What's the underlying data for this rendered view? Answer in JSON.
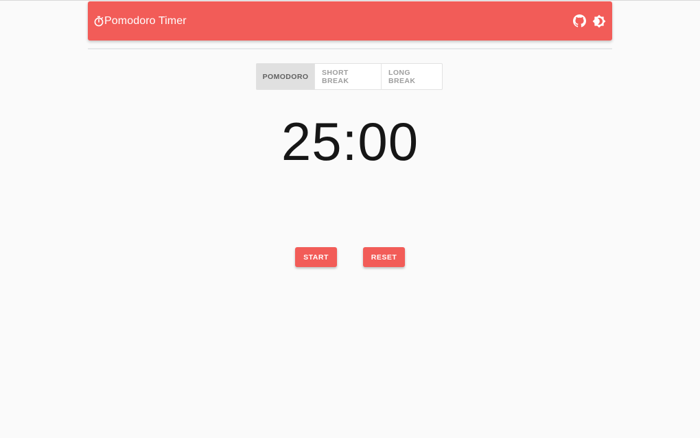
{
  "header": {
    "title": "Pomodoro Timer",
    "brand_icon": "stopwatch-icon",
    "actions": [
      {
        "icon": "github-icon"
      },
      {
        "icon": "brightness-icon"
      }
    ],
    "color": "#f25c58"
  },
  "modes": {
    "tabs": [
      {
        "label": "POMODORO",
        "active": true
      },
      {
        "label": "SHORT BREAK",
        "active": false
      },
      {
        "label": "LONG BREAK",
        "active": false
      }
    ]
  },
  "timer": {
    "display": "25:00"
  },
  "controls": {
    "start_label": "START",
    "reset_label": "RESET"
  },
  "colors": {
    "accent": "#f25c58",
    "background": "#fafafa",
    "timer_text": "#161616"
  }
}
